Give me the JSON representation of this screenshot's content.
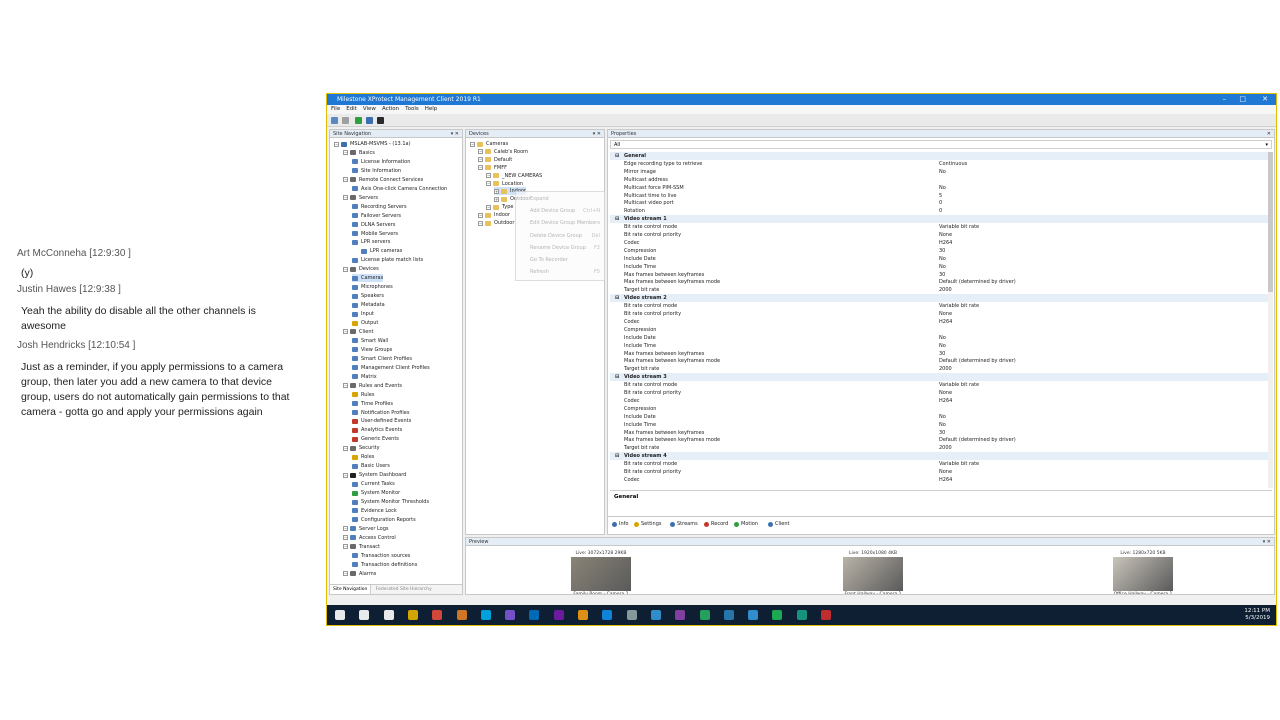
{
  "chat": [
    {
      "name": "Art McConneha [12:9:30 ]",
      "text": "(y)"
    },
    {
      "name": "Justin Hawes [12:9:38 ]",
      "text": "Yeah the ability do disable all the other channels is awesome"
    },
    {
      "name": "Josh Hendricks [12:10:54 ]",
      "text": "Just as a reminder, if you apply permissions to a camera group, then later you add a new camera to that device group, users do not automatically gain permissions to that camera - gotta go and apply your permissions again"
    }
  ],
  "window": {
    "title": "Milestone XProtect Management Client 2019 R1",
    "menu": [
      "File",
      "Edit",
      "View",
      "Action",
      "Tools",
      "Help"
    ]
  },
  "site_nav": {
    "header": "Site Navigation",
    "items": [
      {
        "label": "MSLAB-MSVMS - (13.1a)",
        "level": 0,
        "color": "#3b6fb0"
      },
      {
        "label": "Basics",
        "level": 1,
        "color": "#6a6a6a"
      },
      {
        "label": "License Information",
        "level": 2,
        "color": "#4f7fbf"
      },
      {
        "label": "Site Information",
        "level": 2,
        "color": "#4f7fbf"
      },
      {
        "label": "Remote Connect Services",
        "level": 1,
        "color": "#6a6a6a"
      },
      {
        "label": "Axis One-click Camera Connection",
        "level": 2,
        "color": "#4f7fbf"
      },
      {
        "label": "Servers",
        "level": 1,
        "color": "#6a6a6a"
      },
      {
        "label": "Recording Servers",
        "level": 2,
        "color": "#4f7fbf"
      },
      {
        "label": "Failover Servers",
        "level": 2,
        "color": "#4f7fbf"
      },
      {
        "label": "DLNA Servers",
        "level": 2,
        "color": "#4f7fbf"
      },
      {
        "label": "Mobile Servers",
        "level": 2,
        "color": "#4f7fbf"
      },
      {
        "label": "LPR servers",
        "level": 2,
        "color": "#4f7fbf"
      },
      {
        "label": "LPR cameras",
        "level": 3,
        "color": "#4f7fbf"
      },
      {
        "label": "License plate match lists",
        "level": 2,
        "color": "#4f7fbf"
      },
      {
        "label": "Devices",
        "level": 1,
        "color": "#6a6a6a"
      },
      {
        "label": "Cameras",
        "level": 2,
        "color": "#4f7fbf",
        "selected": true
      },
      {
        "label": "Microphones",
        "level": 2,
        "color": "#4f7fbf"
      },
      {
        "label": "Speakers",
        "level": 2,
        "color": "#4f7fbf"
      },
      {
        "label": "Metadata",
        "level": 2,
        "color": "#4f7fbf"
      },
      {
        "label": "Input",
        "level": 2,
        "color": "#4f7fbf"
      },
      {
        "label": "Output",
        "level": 2,
        "color": "#d9a400"
      },
      {
        "label": "Client",
        "level": 1,
        "color": "#6a6a6a"
      },
      {
        "label": "Smart Wall",
        "level": 2,
        "color": "#4f7fbf"
      },
      {
        "label": "View Groups",
        "level": 2,
        "color": "#4f7fbf"
      },
      {
        "label": "Smart Client Profiles",
        "level": 2,
        "color": "#4f7fbf"
      },
      {
        "label": "Management Client Profiles",
        "level": 2,
        "color": "#4f7fbf"
      },
      {
        "label": "Matrix",
        "level": 2,
        "color": "#4f7fbf"
      },
      {
        "label": "Rules and Events",
        "level": 1,
        "color": "#6a6a6a"
      },
      {
        "label": "Rules",
        "level": 2,
        "color": "#d9a400"
      },
      {
        "label": "Time Profiles",
        "level": 2,
        "color": "#4f7fbf"
      },
      {
        "label": "Notification Profiles",
        "level": 2,
        "color": "#4f7fbf"
      },
      {
        "label": "User-defined Events",
        "level": 2,
        "color": "#c0392b"
      },
      {
        "label": "Analytics Events",
        "level": 2,
        "color": "#c0392b"
      },
      {
        "label": "Generic Events",
        "level": 2,
        "color": "#c0392b"
      },
      {
        "label": "Security",
        "level": 1,
        "color": "#6a6a6a"
      },
      {
        "label": "Roles",
        "level": 2,
        "color": "#d9a400"
      },
      {
        "label": "Basic Users",
        "level": 2,
        "color": "#4f7fbf"
      },
      {
        "label": "System Dashboard",
        "level": 1,
        "color": "#222222"
      },
      {
        "label": "Current Tasks",
        "level": 2,
        "color": "#4f7fbf"
      },
      {
        "label": "System Monitor",
        "level": 2,
        "color": "#2e9e3e"
      },
      {
        "label": "System Monitor Thresholds",
        "level": 2,
        "color": "#4f7fbf"
      },
      {
        "label": "Evidence Lock",
        "level": 2,
        "color": "#4f7fbf"
      },
      {
        "label": "Configuration Reports",
        "level": 2,
        "color": "#4f7fbf"
      },
      {
        "label": "Server Logs",
        "level": 1,
        "color": "#4f7fbf"
      },
      {
        "label": "Access Control",
        "level": 1,
        "color": "#4f7fbf"
      },
      {
        "label": "Transact",
        "level": 1,
        "color": "#6a6a6a"
      },
      {
        "label": "Transaction sources",
        "level": 2,
        "color": "#4f7fbf"
      },
      {
        "label": "Transaction definitions",
        "level": 2,
        "color": "#4f7fbf"
      },
      {
        "label": "Alarms",
        "level": 1,
        "color": "#6a6a6a"
      }
    ],
    "bottom_tabs": [
      "Site Navigation",
      "Federated Site Hierarchy"
    ]
  },
  "devices": {
    "header": "Devices",
    "items": [
      {
        "label": "Cameras",
        "level": 0
      },
      {
        "label": "Caleb's Room",
        "level": 1
      },
      {
        "label": "Default",
        "level": 1
      },
      {
        "label": "FMFF",
        "level": 1
      },
      {
        "label": "_NEW CAMERAS",
        "level": 2
      },
      {
        "label": "Location",
        "level": 2
      },
      {
        "label": "Indoor",
        "level": 3,
        "selected": true
      },
      {
        "label": "Outdoor",
        "level": 3
      },
      {
        "label": "Type",
        "level": 2
      },
      {
        "label": "Indoor",
        "level": 1
      },
      {
        "label": "Outdoor",
        "level": 1
      }
    ]
  },
  "context_menu": {
    "items": [
      {
        "label": "Expand",
        "key": ""
      },
      {
        "label": "Add Device Group",
        "key": "Ctrl+N"
      },
      {
        "label": "Edit Device Group Members",
        "key": ""
      },
      {
        "label": "Delete Device Group",
        "key": "Del"
      },
      {
        "label": "Rename Device Group",
        "key": "F2"
      },
      {
        "label": "Go To Recorder",
        "key": ""
      },
      {
        "label": "Refresh",
        "key": "F5"
      }
    ]
  },
  "properties": {
    "header": "Properties",
    "filter": "All",
    "rows": [
      {
        "group": true,
        "key": "General"
      },
      {
        "key": "Edge recording type to retrieve",
        "value": "Continuous"
      },
      {
        "key": "Mirror image",
        "value": "No"
      },
      {
        "key": "Multicast address",
        "value": ""
      },
      {
        "key": "Multicast force PIM-SSM",
        "value": "No"
      },
      {
        "key": "Multicast time to live",
        "value": "5"
      },
      {
        "key": "Multicast video port",
        "value": "0"
      },
      {
        "key": "Rotation",
        "value": "0"
      },
      {
        "group": true,
        "key": "Video stream 1"
      },
      {
        "key": "Bit rate control mode",
        "value": "Variable bit rate"
      },
      {
        "key": "Bit rate control priority",
        "value": "None"
      },
      {
        "key": "Codec",
        "value": "H264"
      },
      {
        "key": "Compression",
        "value": "30"
      },
      {
        "key": "Include Date",
        "value": "No"
      },
      {
        "key": "Include Time",
        "value": "No"
      },
      {
        "key": "Max frames between keyframes",
        "value": "30"
      },
      {
        "key": "Max frames between keyframes mode",
        "value": "Default (determined by driver)"
      },
      {
        "key": "Target bit rate",
        "value": "2000"
      },
      {
        "group": true,
        "key": "Video stream 2"
      },
      {
        "key": "Bit rate control mode",
        "value": "Variable bit rate"
      },
      {
        "key": "Bit rate control priority",
        "value": "None"
      },
      {
        "key": "Codec",
        "value": "H264"
      },
      {
        "key": "Compression",
        "value": ""
      },
      {
        "key": "Include Date",
        "value": "No"
      },
      {
        "key": "Include Time",
        "value": "No"
      },
      {
        "key": "Max frames between keyframes",
        "value": "30"
      },
      {
        "key": "Max frames between keyframes mode",
        "value": "Default (determined by driver)"
      },
      {
        "key": "Target bit rate",
        "value": "2000"
      },
      {
        "group": true,
        "key": "Video stream 3"
      },
      {
        "key": "Bit rate control mode",
        "value": "Variable bit rate"
      },
      {
        "key": "Bit rate control priority",
        "value": "None"
      },
      {
        "key": "Codec",
        "value": "H264"
      },
      {
        "key": "Compression",
        "value": ""
      },
      {
        "key": "Include Date",
        "value": "No"
      },
      {
        "key": "Include Time",
        "value": "No"
      },
      {
        "key": "Max frames between keyframes",
        "value": "30"
      },
      {
        "key": "Max frames between keyframes mode",
        "value": "Default (determined by driver)"
      },
      {
        "key": "Target bit rate",
        "value": "2000"
      },
      {
        "group": true,
        "key": "Video stream 4"
      },
      {
        "key": "Bit rate control mode",
        "value": "Variable bit rate"
      },
      {
        "key": "Bit rate control priority",
        "value": "None"
      },
      {
        "key": "Codec",
        "value": "H264"
      }
    ],
    "description_title": "General",
    "tabs": [
      {
        "label": "Info",
        "color": "#3b6fb0"
      },
      {
        "label": "Settings",
        "color": "#d9a400"
      },
      {
        "label": "Streams",
        "color": "#3b6fb0"
      },
      {
        "label": "Record",
        "color": "#c0392b"
      },
      {
        "label": "Motion",
        "color": "#2e9e3e"
      },
      {
        "label": "Client",
        "color": "#3b6fb0"
      }
    ]
  },
  "preview": {
    "header": "Preview",
    "cameras": [
      {
        "info": "Live: 3072x1728 29KB",
        "name": "Family Room - Camera 1"
      },
      {
        "info": "Live: 1920x1080 4KB",
        "name": "Front Hallway - Camera 1"
      },
      {
        "info": "Live: 1280x720 5KB",
        "name": "Office Hallway - Camera 1"
      }
    ]
  },
  "taskbar": {
    "time": "12:11 PM",
    "date": "5/3/2019",
    "icons": [
      {
        "name": "start-icon",
        "color": "#ffffff"
      },
      {
        "name": "search-icon",
        "color": "#ffffff"
      },
      {
        "name": "task-view-icon",
        "color": "#ffffff"
      },
      {
        "name": "file-explorer-icon",
        "color": "#e8b400"
      },
      {
        "name": "chrome-icon",
        "color": "#e74c3c"
      },
      {
        "name": "firefox-icon",
        "color": "#e67e22"
      },
      {
        "name": "skype-icon",
        "color": "#00aff0"
      },
      {
        "name": "visual-studio-icon",
        "color": "#7f56d9"
      },
      {
        "name": "outlook-icon",
        "color": "#0072c6"
      },
      {
        "name": "onenote-icon",
        "color": "#7719aa"
      },
      {
        "name": "sublime-icon",
        "color": "#f39c12"
      },
      {
        "name": "teamviewer-icon",
        "color": "#0e8ee9"
      },
      {
        "name": "network-icon",
        "color": "#95a5a6"
      },
      {
        "name": "settings-icon",
        "color": "#3498db"
      },
      {
        "name": "milestone-icon",
        "color": "#8e44ad"
      },
      {
        "name": "app-icon",
        "color": "#27ae60"
      },
      {
        "name": "remote-icon",
        "color": "#2980b9"
      },
      {
        "name": "xprotect-icon",
        "color": "#3498db"
      },
      {
        "name": "spotify-icon",
        "color": "#1db954"
      },
      {
        "name": "terminal-icon",
        "color": "#16a085"
      },
      {
        "name": "acrobat-icon",
        "color": "#d32f2f"
      }
    ]
  }
}
